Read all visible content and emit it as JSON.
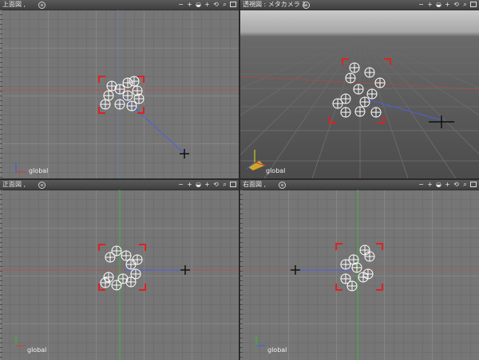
{
  "panes": [
    {
      "key": "top",
      "title": "上面図 ,",
      "tools": [
        "−",
        "+",
        "◒",
        "+",
        "⟲",
        "⌕",
        "□"
      ],
      "axis_label": "global"
    },
    {
      "key": "persp",
      "title": "透視図 : メタカメラ 1 ,",
      "tools": [
        "−",
        "+",
        "◒",
        "+",
        "⟲",
        "⌕",
        "□"
      ],
      "axis_label": "global"
    },
    {
      "key": "front",
      "title": "正面図 ,",
      "tools": [
        "−",
        "+",
        "◒",
        "+",
        "⟲",
        "⌕",
        "□"
      ],
      "axis_label": "global"
    },
    {
      "key": "right",
      "title": "右面図 ,",
      "tools": [
        "−",
        "+",
        "◒",
        "+",
        "⟲",
        "⌕",
        "□"
      ],
      "axis_label": "global"
    }
  ],
  "colors": {
    "selection": "#e02020",
    "object_stroke": "#ffffff",
    "x_axis": "#d23a3a",
    "y_axis": "#33c033",
    "z_axis": "#3d5fe0",
    "link_line": "#4a60e0"
  },
  "icons": [
    "minus-icon",
    "plus-icon",
    "camera-icon",
    "move-icon",
    "rotate-icon",
    "zoom-icon",
    "maximize-icon",
    "pane-options-icon"
  ]
}
